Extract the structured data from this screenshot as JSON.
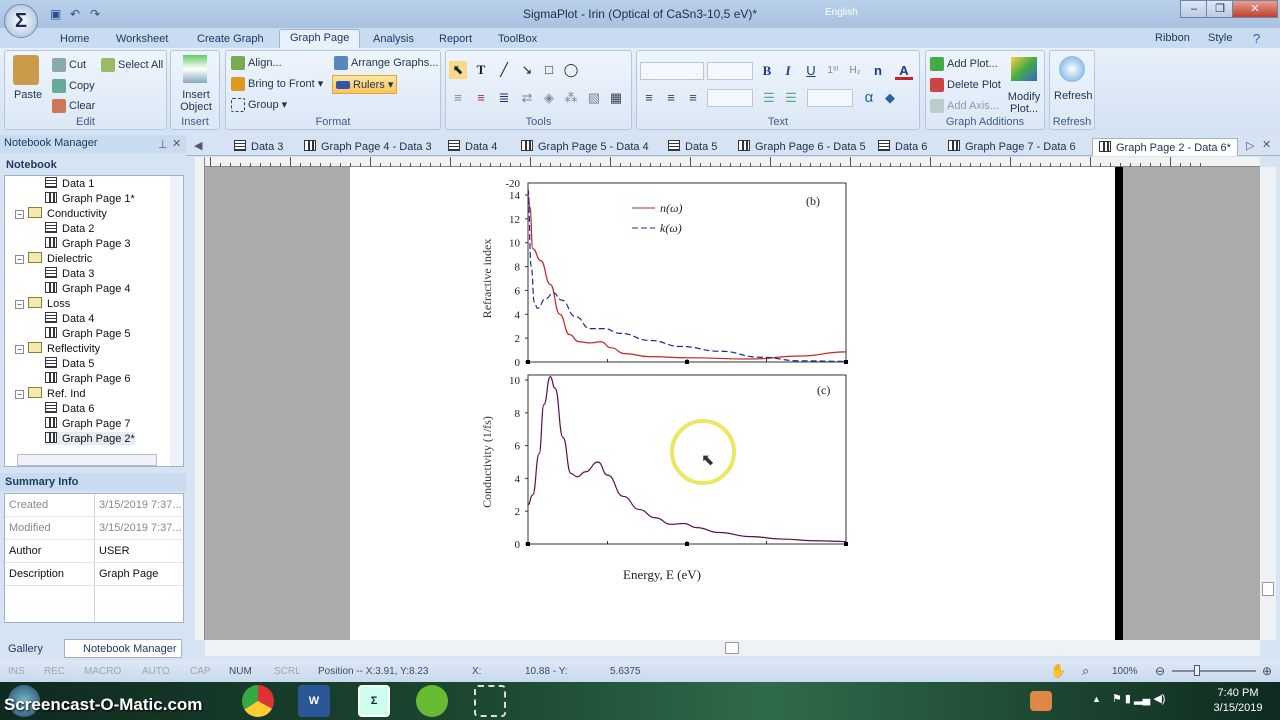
{
  "window": {
    "title": "SigmaPlot - Irin (Optical of CaSn3-10,5 eV)*",
    "language": "English",
    "app_icon": "Σ"
  },
  "ribbon_tabs": [
    "Home",
    "Worksheet",
    "Create Graph",
    "Graph Page",
    "Analysis",
    "Report",
    "ToolBox"
  ],
  "ribbon_right": {
    "ribbon": "Ribbon",
    "style": "Style"
  },
  "ribbon": {
    "edit": {
      "label": "Edit",
      "paste": "Paste",
      "cut": "Cut",
      "copy": "Copy",
      "clear": "Clear",
      "select_all": "Select All"
    },
    "insert": {
      "label": "Insert",
      "insert_object": "Insert Object"
    },
    "format": {
      "label": "Format",
      "align": "Align...",
      "bring_to_front": "Bring to Front",
      "group": "Group",
      "arrange": "Arrange Graphs...",
      "rulers": "Rulers"
    },
    "tools": {
      "label": "Tools"
    },
    "text": {
      "label": "Text",
      "bold": "B",
      "italic": "I",
      "underline": "U",
      "alpha": "α"
    },
    "graph_additions": {
      "label": "Graph Additions",
      "add_plot": "Add Plot...",
      "delete_plot": "Delete Plot",
      "add_axis": "Add Axis...",
      "modify_plot": "Modify Plot..."
    },
    "refresh": {
      "label": "Refresh",
      "refresh": "Refresh"
    }
  },
  "notebook_manager": {
    "title": "Notebook Manager",
    "section": "Notebook",
    "items": [
      {
        "label": "Data 1",
        "type": "data",
        "level": 2
      },
      {
        "label": "Graph Page 1*",
        "type": "graph",
        "level": 2
      },
      {
        "label": "Conductivity",
        "type": "folder",
        "level": 1
      },
      {
        "label": "Data 2",
        "type": "data",
        "level": 2
      },
      {
        "label": "Graph Page 3",
        "type": "graph",
        "level": 2
      },
      {
        "label": "Dielectric",
        "type": "folder",
        "level": 1
      },
      {
        "label": "Data 3",
        "type": "data",
        "level": 2
      },
      {
        "label": "Graph Page 4",
        "type": "graph",
        "level": 2
      },
      {
        "label": "Loss",
        "type": "folder",
        "level": 1
      },
      {
        "label": "Data 4",
        "type": "data",
        "level": 2
      },
      {
        "label": "Graph Page 5",
        "type": "graph",
        "level": 2
      },
      {
        "label": "Reflectivity",
        "type": "folder",
        "level": 1
      },
      {
        "label": "Data 5",
        "type": "data",
        "level": 2
      },
      {
        "label": "Graph Page 6",
        "type": "graph",
        "level": 2
      },
      {
        "label": "Ref. Ind",
        "type": "folder",
        "level": 1
      },
      {
        "label": "Data 6",
        "type": "data",
        "level": 2
      },
      {
        "label": "Graph Page 7",
        "type": "graph",
        "level": 2
      },
      {
        "label": "Graph Page 2*",
        "type": "graph",
        "level": 2
      }
    ]
  },
  "summary": {
    "title": "Summary Info",
    "rows": [
      {
        "key": "Created",
        "value": "3/15/2019 7:37..."
      },
      {
        "key": "Modified",
        "value": "3/15/2019 7:37..."
      },
      {
        "key": "Author",
        "value": "USER"
      },
      {
        "key": "Description",
        "value": "Graph Page"
      }
    ]
  },
  "bottom_tabs": [
    "Gallery",
    "Notebook Manager"
  ],
  "doc_tabs": [
    {
      "label": "Data 3",
      "type": "data"
    },
    {
      "label": "Graph Page 4 - Data 3",
      "type": "graph"
    },
    {
      "label": "Data 4",
      "type": "data"
    },
    {
      "label": "Graph Page 5 - Data 4",
      "type": "graph"
    },
    {
      "label": "Data 5",
      "type": "data"
    },
    {
      "label": "Graph Page 6 - Data 5",
      "type": "graph"
    },
    {
      "label": "Data 6",
      "type": "data"
    },
    {
      "label": "Graph Page 7 - Data 6",
      "type": "graph"
    },
    {
      "label": "Graph Page 2 - Data 6*",
      "type": "graph",
      "active": true
    }
  ],
  "status": {
    "ins": "INS",
    "rec": "REC",
    "macro": "MACRO",
    "auto": "AUTO",
    "cap": "CAP",
    "num": "NUM",
    "scrl": "SCRL",
    "position": "Position -- X:3.91, Y:8.23",
    "x_label": "X:",
    "x_value": "10.88 - Y:",
    "y_value": "5.6375",
    "zoom": "100%"
  },
  "taskbar": {
    "watermark": "Screencast-O-Matic.com",
    "time": "7:40 PM",
    "date": "3/15/2019"
  },
  "chart_data": [
    {
      "type": "line",
      "panel": "(b)",
      "ylabel": "Refractive index",
      "ylim": [
        0,
        14
      ],
      "yticks": [
        0,
        2,
        4,
        6,
        8,
        10,
        12,
        14
      ],
      "extra_top_tick": "-20",
      "xlim": [
        0,
        10
      ],
      "series": [
        {
          "name": "n(ω)",
          "color": "#cc2222",
          "style": "solid",
          "x": [
            0,
            0.06,
            0.15,
            0.4,
            0.7,
            1.0,
            1.3,
            1.6,
            1.95,
            2.3,
            2.6,
            3.05,
            3.8,
            5.1,
            7,
            8.55,
            10
          ],
          "y": [
            14,
            13,
            9.5,
            8.5,
            6.5,
            4,
            2.3,
            1.7,
            1.6,
            1.7,
            1.2,
            0.7,
            0.45,
            0.35,
            0.25,
            0.5,
            0.85
          ]
        },
        {
          "name": "k(ω)",
          "color": "#1a2a9a",
          "style": "dashed",
          "x": [
            0,
            0.1,
            0.2,
            0.3,
            0.55,
            0.8,
            1.05,
            1.5,
            1.95,
            2.4,
            2.9,
            3.85,
            4.8,
            6.05,
            7.3,
            8.55,
            10
          ],
          "y": [
            14.5,
            8,
            5,
            4.5,
            5.3,
            5.8,
            5.2,
            3.8,
            2.8,
            2.8,
            2.4,
            1.8,
            1.3,
            0.9,
            0.4,
            0.1,
            0.05
          ]
        }
      ]
    },
    {
      "type": "line",
      "panel": "(c)",
      "ylabel": "Conductivity (1/fs)",
      "xlabel": "Energy, E (eV)",
      "ylim": [
        0,
        10
      ],
      "yticks": [
        0,
        2,
        4,
        6,
        8,
        10
      ],
      "xlim": [
        0,
        10
      ],
      "series": [
        {
          "name": "Conductivity",
          "color": "#5a1050",
          "style": "solid",
          "x": [
            0,
            0.15,
            0.35,
            0.5,
            0.7,
            0.85,
            1.1,
            1.35,
            1.55,
            1.8,
            2.2,
            2.5,
            3,
            3.5,
            4,
            4.5,
            4.9,
            5.3,
            6,
            7,
            8,
            9,
            10
          ],
          "y": [
            2.4,
            3,
            5.5,
            8.5,
            10.2,
            9.5,
            6.5,
            4.3,
            4.1,
            4.4,
            5,
            4.2,
            2.9,
            2.1,
            1.6,
            1.2,
            1.25,
            1.0,
            0.7,
            0.45,
            0.3,
            0.2,
            0.15
          ]
        }
      ]
    }
  ]
}
